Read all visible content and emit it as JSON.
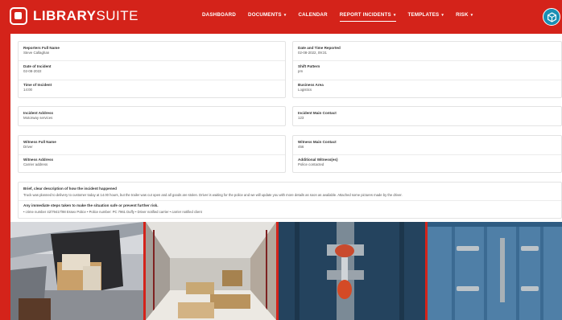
{
  "app": {
    "brand_bold": "LIBRARY",
    "brand_light": "SUITE"
  },
  "nav": {
    "items": [
      {
        "label": "DASHBOARD",
        "dropdown": false,
        "active": false
      },
      {
        "label": "DOCUMENTS",
        "dropdown": true,
        "active": false
      },
      {
        "label": "CALENDAR",
        "dropdown": false,
        "active": false
      },
      {
        "label": "REPORT INCIDENTS",
        "dropdown": true,
        "active": true
      },
      {
        "label": "TEMPLATES",
        "dropdown": true,
        "active": false
      },
      {
        "label": "RISK",
        "dropdown": true,
        "active": false
      }
    ]
  },
  "report": {
    "reporter_name": {
      "label": "Reporters Full Name",
      "value": "Steve Callaghan"
    },
    "date_time_reported": {
      "label": "Date and Time Reported",
      "value": "02-08-2022, 09:31"
    },
    "date_of_incident": {
      "label": "Date of Incident",
      "value": "02-08-2022"
    },
    "shift_pattern": {
      "label": "Shift Pattern",
      "value": "pm"
    },
    "time_of_incident": {
      "label": "Time of Incident",
      "value": "14:00"
    },
    "business_area": {
      "label": "Business Area",
      "value": "Logistics"
    },
    "incident_address": {
      "label": "Incident Address",
      "value": "Motorway services"
    },
    "incident_contact": {
      "label": "Incident Main Contact",
      "value": "123"
    },
    "witness_name": {
      "label": "Witness Full Name",
      "value": "Driver"
    },
    "witness_contact": {
      "label": "Witness Main Contact",
      "value": "456"
    },
    "witness_address": {
      "label": "Witness Address",
      "value": "Carrier address"
    },
    "additional_witnesses": {
      "label": "Additional Witness(es)",
      "value": "Police contacted"
    },
    "description": {
      "label": "Brief, clear description of how the incident happened",
      "value": "Truck was planned to delivery to customer today at 14.00 hours, but the trailer was cut open and all goods are stolen. Driver is waiting for the police and we will update you with more details as soon as available. Attached some pictures made by the driver."
    },
    "steps": {
      "label": "Any immediate steps taken to make the situation safe or prevent further risk.",
      "value": "• crime number 42/79417/98 Essex Police • Police number: PC 7961 Duffy • Driver notified carrier • carrier notified client"
    }
  },
  "colors": {
    "brand_red": "#d4231a",
    "user_badge": "#1a8fb3"
  },
  "icons": {
    "logo": "library-suite-logo-icon",
    "user": "user-avatar-icon",
    "caret": "chevron-down-icon"
  },
  "photos": [
    {
      "name": "photo-cut-trailer"
    },
    {
      "name": "photo-empty-trailer-pallets"
    },
    {
      "name": "photo-container-seal"
    },
    {
      "name": "photo-container-doors"
    }
  ]
}
